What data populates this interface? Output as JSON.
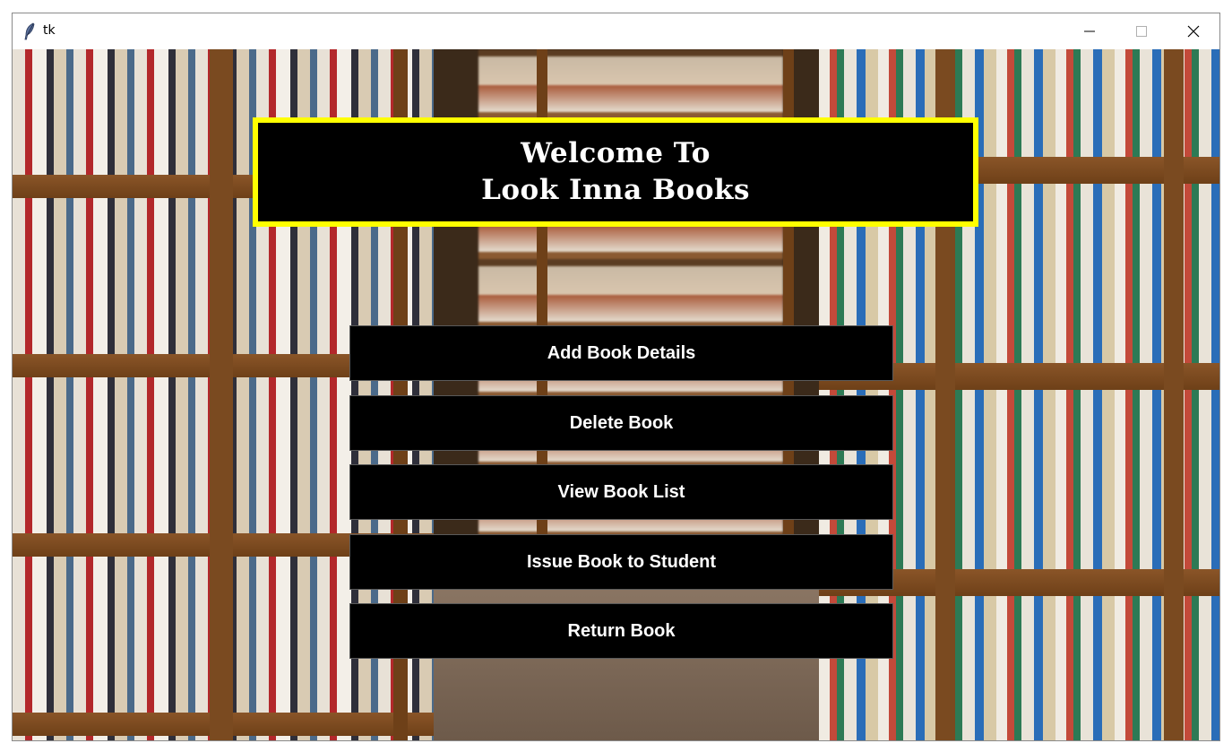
{
  "window": {
    "title": "tk",
    "icon": "feather-icon",
    "controls": [
      "minimize-icon",
      "maximize-icon",
      "close-icon"
    ]
  },
  "background": {
    "description_icon": "library-bookshelf-photo"
  },
  "header": {
    "line1": "Welcome To",
    "line2": "Look Inna Books",
    "border_color": "#ffff00",
    "background_color": "#000000"
  },
  "menu": {
    "items": [
      {
        "label": "Add Book Details"
      },
      {
        "label": "Delete Book"
      },
      {
        "label": "View Book List"
      },
      {
        "label": "Issue Book to Student"
      },
      {
        "label": "Return Book"
      }
    ],
    "button_color": "#000000",
    "text_color": "#ffffff"
  }
}
